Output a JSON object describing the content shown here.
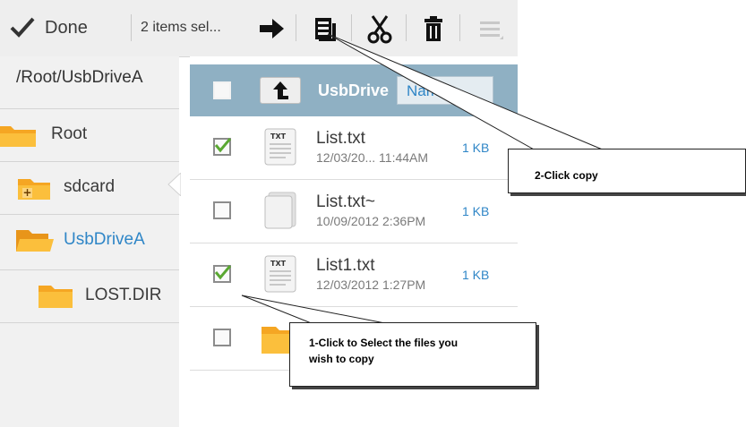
{
  "toolbar": {
    "done_label": "Done",
    "selection_count": "2 items sel...",
    "icons": [
      "check-icon",
      "move-arrow-icon",
      "copy-icon",
      "cut-icon",
      "delete-icon",
      "menu-icon"
    ]
  },
  "sidebar": {
    "path": "/Root/UsbDriveA",
    "items": [
      {
        "label": "Root",
        "icon": "folder-icon",
        "selected": false
      },
      {
        "label": "sdcard",
        "icon": "sdcard-folder-icon",
        "selected": false
      },
      {
        "label": "UsbDriveA",
        "icon": "folder-open-icon",
        "selected": true
      },
      {
        "label": "LOST.DIR",
        "icon": "folder-icon",
        "selected": false
      }
    ]
  },
  "file_list": {
    "header_title": "UsbDrive",
    "sort_label": "Nam",
    "files": [
      {
        "name": "List.txt",
        "date": "12/03/20... 11:44AM",
        "size": "1 KB",
        "checked": true,
        "icon": "txt-file-icon"
      },
      {
        "name": "List.txt~",
        "date": "10/09/2012 2:36PM",
        "size": "1 KB",
        "checked": false,
        "icon": "blank-file-icon"
      },
      {
        "name": "List1.txt",
        "date": "12/03/2012 1:27PM",
        "size": "1 KB",
        "checked": true,
        "icon": "txt-file-icon"
      },
      {
        "name": "",
        "date": "",
        "size": "",
        "checked": false,
        "icon": "folder-icon"
      }
    ]
  },
  "callouts": {
    "copy": "2-Click copy",
    "select_line1": "1-Click to Select the files you",
    "select_line2": "wish to copy"
  },
  "colors": {
    "accent_blue": "#2f86c7",
    "header_bg": "#8fb0c3",
    "folder_orange": "#f5a623",
    "check_green": "#5aa832"
  }
}
